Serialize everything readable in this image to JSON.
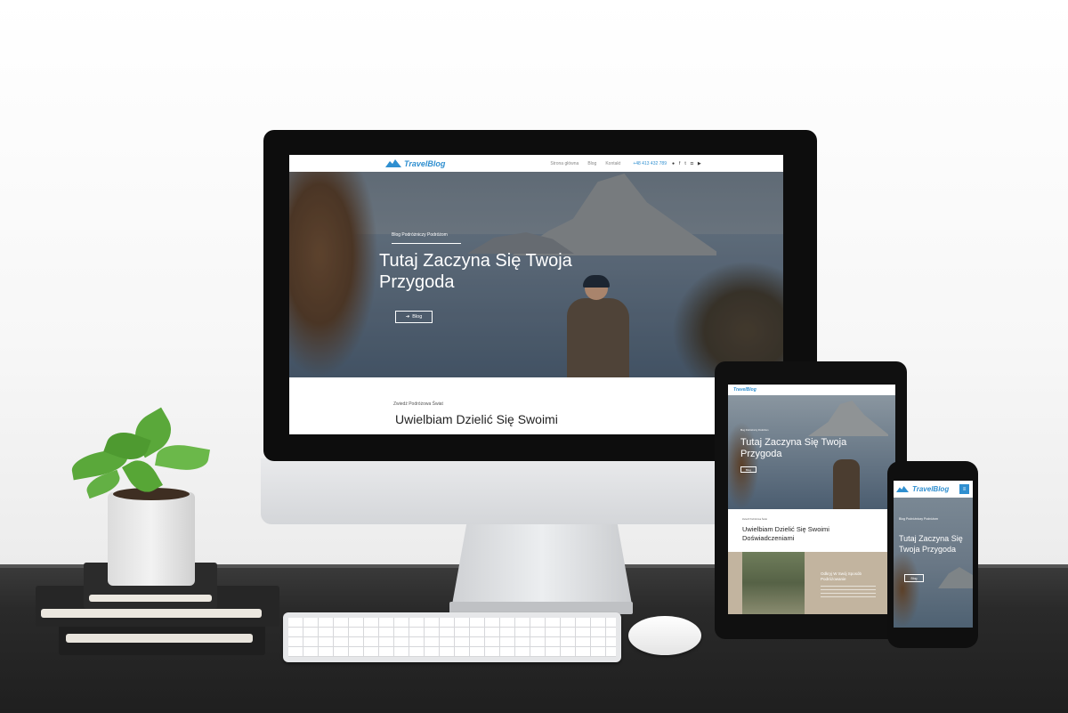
{
  "desktop": {
    "nav": {
      "logo": "TravelBlog",
      "links": [
        "Strona główna",
        "Blog",
        "Kontakt"
      ],
      "phone": "+48 413 432 789",
      "social_icons": [
        "user-icon",
        "facebook-icon",
        "twitter-icon",
        "instagram-icon",
        "youtube-icon"
      ]
    },
    "hero": {
      "subtitle": "Blog Podróżniczy Podróżom",
      "title": "Tutaj Zaczyna Się Twoja Przygoda",
      "button": "Blog"
    },
    "section": {
      "subtitle": "Zwiedź Podróżowa Świat",
      "title": "Uwielbiam Dzielić Się Swoimi"
    }
  },
  "tablet": {
    "logo": "TravelBlog",
    "hero": {
      "subtitle": "Blog Podróżniczy Podróżom",
      "title": "Tutaj Zaczyna Się Twoja Przygoda",
      "button": "Blog"
    },
    "section": {
      "subtitle": "Zwiedź Podróżowa Świat",
      "title": "Uwielbiam Dzielić Się Swoimi Doświadczeniami"
    },
    "card": {
      "title": "Odkryj W Swój Sposób Podróżowanie"
    }
  },
  "phone": {
    "logo": "TravelBlog",
    "menu": "≡",
    "hero": {
      "subtitle": "Blog Podróżniczy Podróżom",
      "title": "Tutaj Zaczyna Się Twoja Przygoda",
      "button": "Blog"
    }
  },
  "colors": {
    "brand": "#2f8fd0",
    "accent_card": "#c2b49f"
  }
}
